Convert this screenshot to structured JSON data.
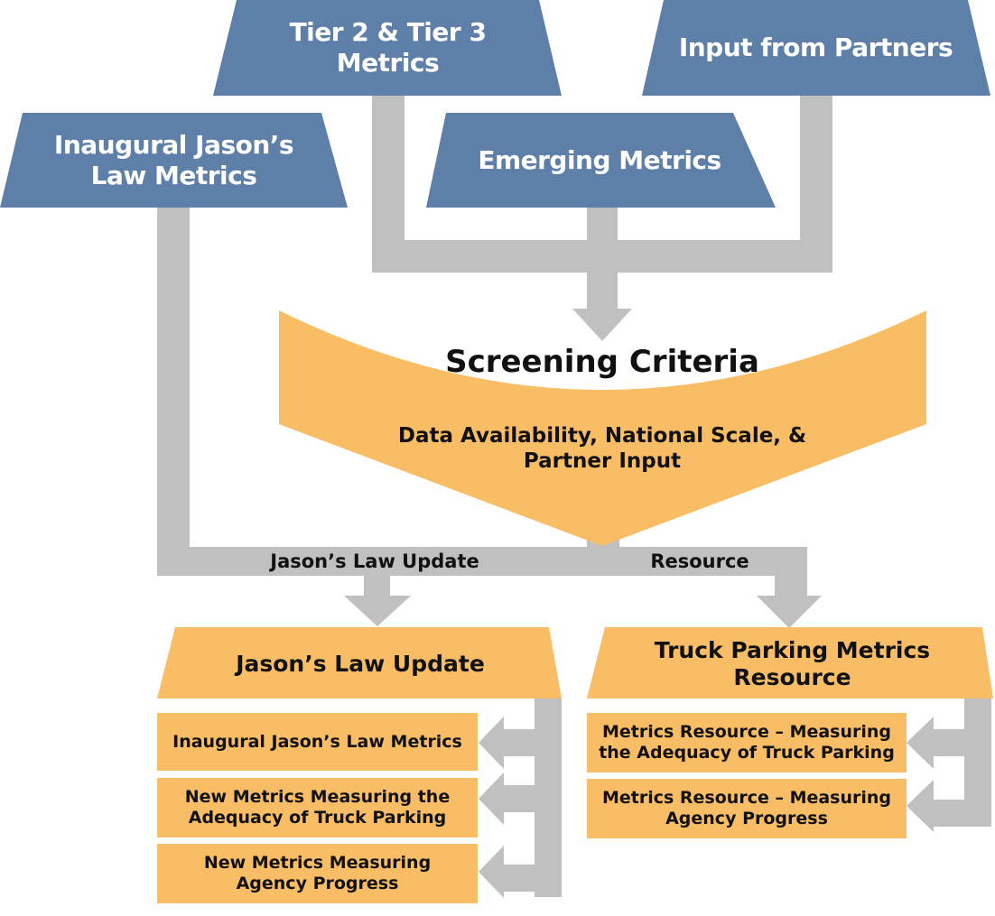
{
  "colors": {
    "input_box": "#5e80a8",
    "process": "#f9bd65",
    "connector": "#c0c0c0",
    "input_text": "#ffffff",
    "output_text": "#111111"
  },
  "inputs": {
    "tier_metrics": "Tier 2 & Tier 3 Metrics",
    "partner_input": "Input from Partners",
    "inaugural_metrics": "Inaugural Jason’s Law Metrics",
    "emerging_metrics": "Emerging Metrics"
  },
  "screening": {
    "title": "Screening Criteria",
    "criteria": "Data Availability, National Scale, & Partner Input"
  },
  "connectors": {
    "left_label": "Jason’s Law Update",
    "right_label": "Resource"
  },
  "outputs": {
    "jasons_law_update": {
      "title": "Jason’s Law Update",
      "items": [
        "Inaugural Jason’s Law Metrics",
        "New Metrics Measuring the Adequacy of Truck Parking",
        "New Metrics Measuring Agency Progress"
      ]
    },
    "truck_parking_resource": {
      "title": "Truck Parking Metrics Resource",
      "items": [
        "Metrics Resource – Measuring the Adequacy of Truck Parking",
        "Metrics Resource – Measuring Agency Progress"
      ]
    }
  }
}
